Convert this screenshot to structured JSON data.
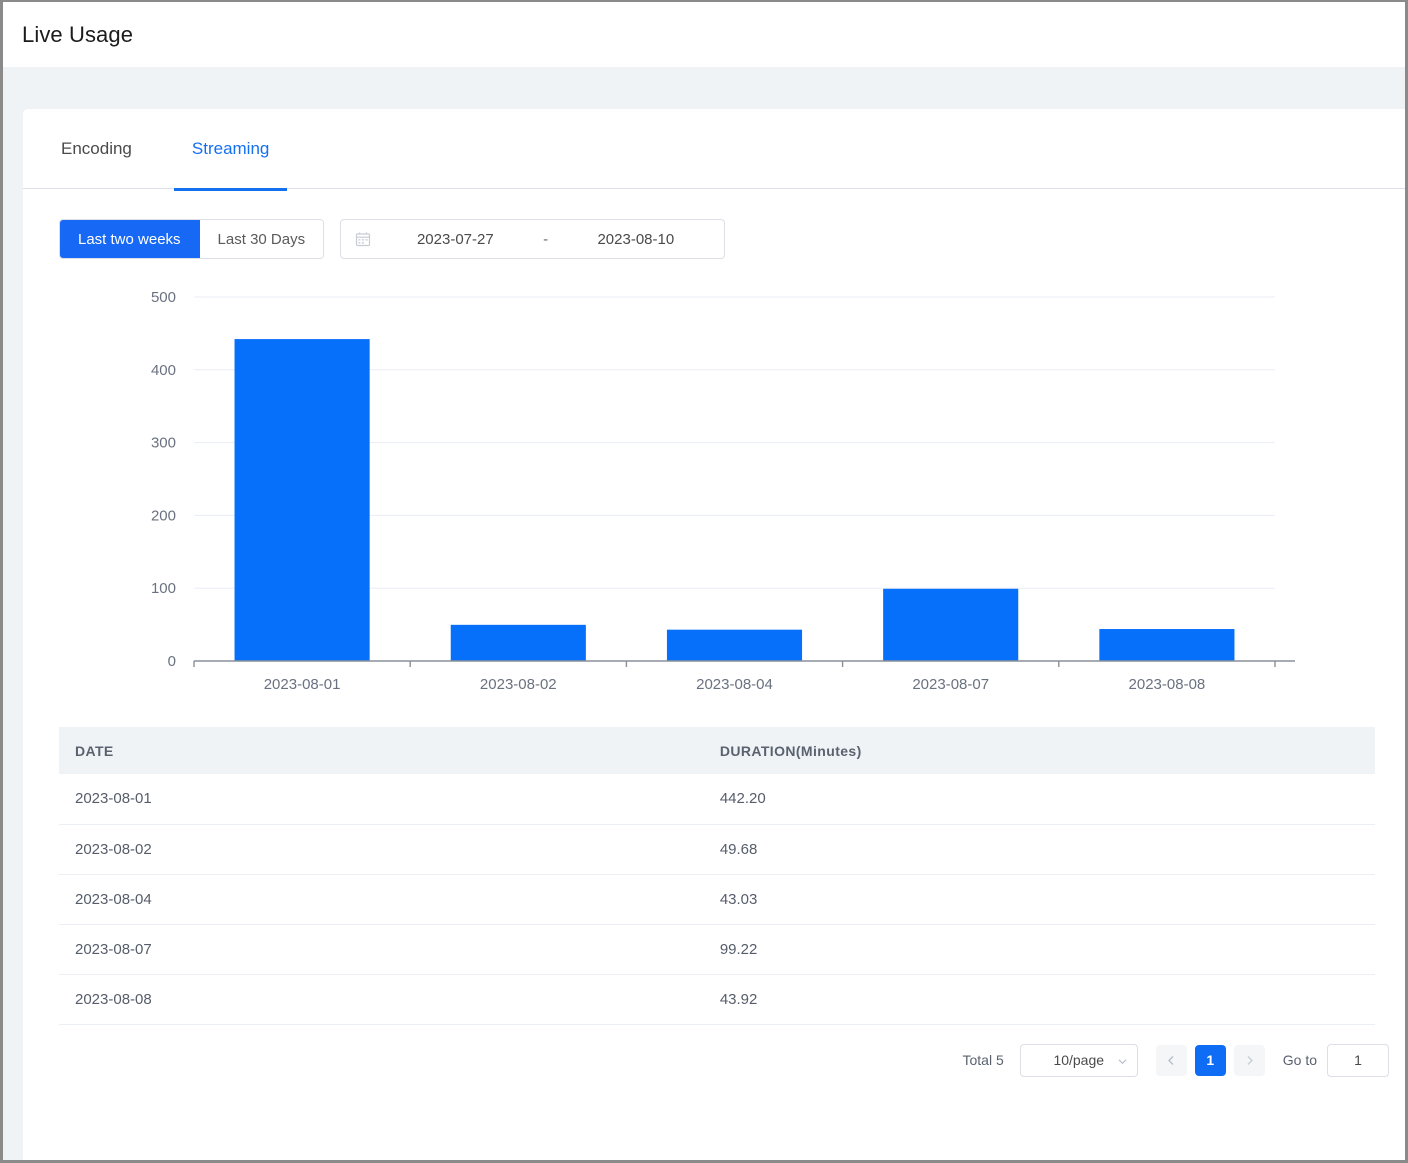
{
  "header": {
    "title": "Live Usage"
  },
  "tabs": [
    {
      "label": "Encoding",
      "active": false
    },
    {
      "label": "Streaming",
      "active": true
    }
  ],
  "filters": {
    "range_buttons": [
      {
        "label": "Last two weeks",
        "active": true
      },
      {
        "label": "Last 30 Days",
        "active": false
      }
    ],
    "date_picker": {
      "icon": "calendar-icon",
      "start": "2023-07-27",
      "separator": "-",
      "end": "2023-08-10"
    }
  },
  "chart_data": {
    "type": "bar",
    "title": "",
    "xlabel": "",
    "ylabel": "",
    "categories": [
      "2023-08-01",
      "2023-08-02",
      "2023-08-04",
      "2023-08-07",
      "2023-08-08"
    ],
    "values": [
      442.2,
      49.68,
      43.03,
      99.22,
      43.92
    ],
    "yticks": [
      0,
      100,
      200,
      300,
      400,
      500
    ],
    "ylim": [
      0,
      500
    ],
    "grid": true,
    "legend": "none",
    "bar_color": "#0670fa",
    "axis_color": "#8a8f99",
    "grid_color": "#eaeef5",
    "tick_label_color": "#6a7280"
  },
  "table": {
    "columns": [
      "DATE",
      "DURATION(Minutes)"
    ],
    "rows": [
      {
        "date": "2023-08-01",
        "duration": "442.20"
      },
      {
        "date": "2023-08-02",
        "duration": "49.68"
      },
      {
        "date": "2023-08-04",
        "duration": "43.03"
      },
      {
        "date": "2023-08-07",
        "duration": "99.22"
      },
      {
        "date": "2023-08-08",
        "duration": "43.92"
      }
    ]
  },
  "pagination": {
    "total_text": "Total 5",
    "page_size": "10/page",
    "prev_icon": "chevron-left-icon",
    "next_icon": "chevron-right-icon",
    "pages": [
      "1"
    ],
    "current_page": "1",
    "goto_label": "Go to",
    "goto_value": "1"
  },
  "colors": {
    "accent": "#1668f5",
    "bar": "#0670fa",
    "page_bg": "#f0f3f6",
    "header_bg": "#f0f3f6"
  }
}
